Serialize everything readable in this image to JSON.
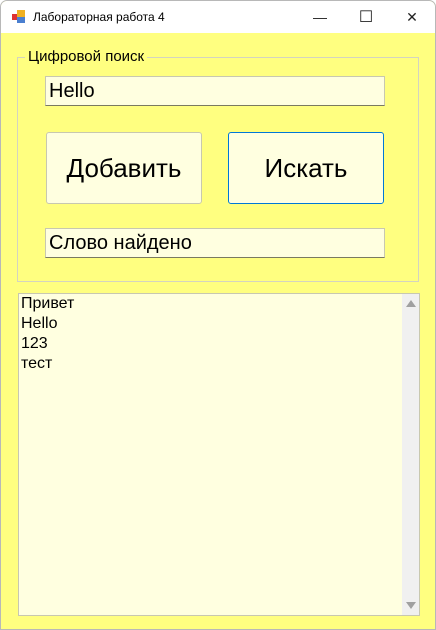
{
  "window": {
    "title": "Лабораторная работа 4",
    "minimize": "—",
    "maximize": "☐",
    "close": "✕"
  },
  "group": {
    "label": "Цифровой поиск"
  },
  "input": {
    "value": "Hello"
  },
  "buttons": {
    "add": "Добавить",
    "search": "Искать"
  },
  "result": {
    "value": "Слово найдено"
  },
  "list": {
    "items": [
      "Привет",
      "Hello",
      "123",
      "тест"
    ]
  }
}
